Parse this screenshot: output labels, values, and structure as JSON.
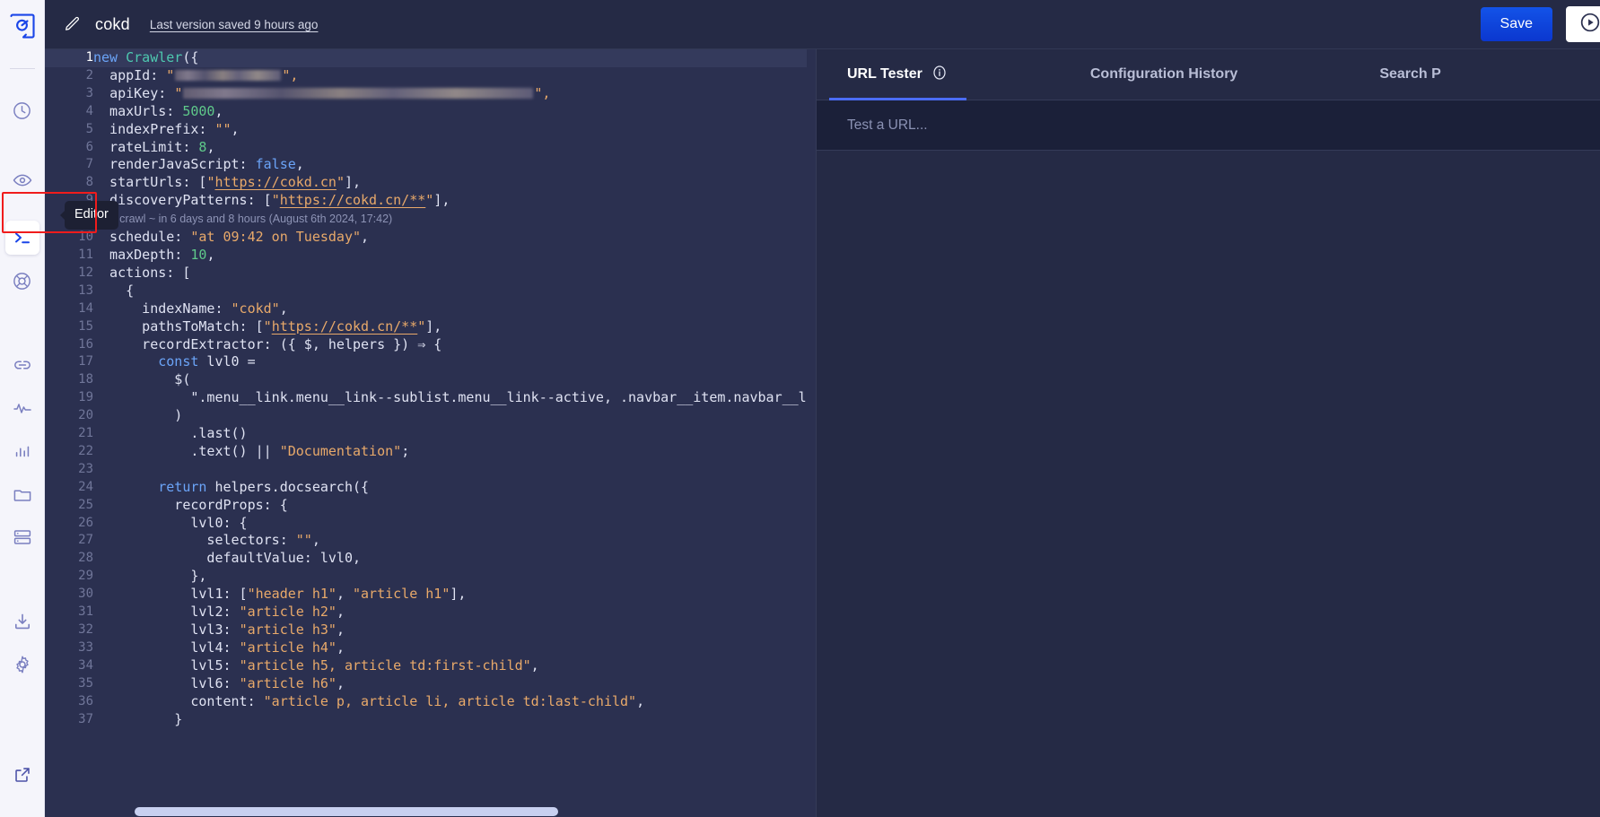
{
  "app": {
    "logo_icon": "algolia-logo-icon",
    "background": "#272c46"
  },
  "sidebar": {
    "items": [
      {
        "id": "history",
        "icon": "clock-icon",
        "selected": false
      },
      {
        "id": "monitoring",
        "icon": "eye-icon",
        "selected": false
      },
      {
        "id": "editor",
        "icon": "terminal-icon",
        "selected": true
      },
      {
        "id": "support",
        "icon": "lifebuoy-icon",
        "selected": false
      },
      {
        "id": "urls",
        "icon": "link-icon",
        "selected": false
      },
      {
        "id": "activity",
        "icon": "pulse-icon",
        "selected": false
      },
      {
        "id": "analytics",
        "icon": "bar-chart-icon",
        "selected": false
      },
      {
        "id": "files",
        "icon": "folder-icon",
        "selected": false
      },
      {
        "id": "indices",
        "icon": "database-icon",
        "selected": false
      },
      {
        "id": "download",
        "icon": "download-icon",
        "selected": false
      },
      {
        "id": "settings",
        "icon": "gear-icon",
        "selected": false
      },
      {
        "id": "external",
        "icon": "external-link-icon",
        "selected": false
      }
    ],
    "tooltip": "Editor",
    "highlight_color": "#f01c1c"
  },
  "header": {
    "edit_icon": "pencil-icon",
    "title": "cokd",
    "saved_status": "Last version saved 9 hours ago",
    "save_label": "Save",
    "run_icon": "play-circle-icon",
    "accent_color": "#0b37cf"
  },
  "editor": {
    "active_line": 1,
    "inline_annotation": {
      "after_line": 9,
      "text": "Next crawl ~ in 6 days and 8 hours (August 6th 2024, 17:42)"
    },
    "lines": [
      {
        "n": 1,
        "text": "new Crawler({"
      },
      {
        "n": 2,
        "text": "  appId: \"██████████\",",
        "redacted": "short"
      },
      {
        "n": 3,
        "text": "  apiKey: \"████████████████████████████████\",",
        "redacted": "long"
      },
      {
        "n": 4,
        "text": "  maxUrls: 5000,"
      },
      {
        "n": 5,
        "text": "  indexPrefix: \"\","
      },
      {
        "n": 6,
        "text": "  rateLimit: 8,"
      },
      {
        "n": 7,
        "text": "  renderJavaScript: false,"
      },
      {
        "n": 8,
        "text": "  startUrls: [\"https://cokd.cn\"],"
      },
      {
        "n": 9,
        "text": "  discoveryPatterns: [\"https://cokd.cn/**\"],"
      },
      {
        "n": 10,
        "text": "  schedule: \"at 09:42 on Tuesday\","
      },
      {
        "n": 11,
        "text": "  maxDepth: 10,"
      },
      {
        "n": 12,
        "text": "  actions: ["
      },
      {
        "n": 13,
        "text": "    {"
      },
      {
        "n": 14,
        "text": "      indexName: \"cokd\","
      },
      {
        "n": 15,
        "text": "      pathsToMatch: [\"https://cokd.cn/**\"],"
      },
      {
        "n": 16,
        "text": "      recordExtractor: ({ $, helpers }) ⇒ {"
      },
      {
        "n": 17,
        "text": "        const lvl0 ="
      },
      {
        "n": 18,
        "text": "          $("
      },
      {
        "n": 19,
        "text": "            \".menu__link.menu__link--sublist.menu__link--active, .navbar__item.navbar__li"
      },
      {
        "n": 20,
        "text": "          )"
      },
      {
        "n": 21,
        "text": "            .last()"
      },
      {
        "n": 22,
        "text": "            .text() || \"Documentation\";"
      },
      {
        "n": 23,
        "text": ""
      },
      {
        "n": 24,
        "text": "        return helpers.docsearch({"
      },
      {
        "n": 25,
        "text": "          recordProps: {"
      },
      {
        "n": 26,
        "text": "            lvl0: {"
      },
      {
        "n": 27,
        "text": "              selectors: \"\","
      },
      {
        "n": 28,
        "text": "              defaultValue: lvl0,"
      },
      {
        "n": 29,
        "text": "            },"
      },
      {
        "n": 30,
        "text": "            lvl1: [\"header h1\", \"article h1\"],"
      },
      {
        "n": 31,
        "text": "            lvl2: \"article h2\","
      },
      {
        "n": 32,
        "text": "            lvl3: \"article h3\","
      },
      {
        "n": 33,
        "text": "            lvl4: \"article h4\","
      },
      {
        "n": 34,
        "text": "            lvl5: \"article h5, article td:first-child\","
      },
      {
        "n": 35,
        "text": "            lvl6: \"article h6\","
      },
      {
        "n": 36,
        "text": "            content: \"article p, article li, article td:last-child\","
      },
      {
        "n": 37,
        "text": "          }"
      }
    ],
    "colors": {
      "background": "#2b3050",
      "active_line": "#343a5c",
      "keyword": "#6ba4f8",
      "class": "#4ec9b0",
      "string": "#e8a96a",
      "number": "#5fc98a",
      "text": "#dfe2f2",
      "line_number": "#707699"
    }
  },
  "panel": {
    "tabs": [
      {
        "id": "url-tester",
        "label": "URL Tester",
        "active": true,
        "info_icon": "info-icon"
      },
      {
        "id": "configuration-history",
        "label": "Configuration History",
        "active": false
      },
      {
        "id": "search-preview",
        "label": "Search P",
        "active": false
      }
    ],
    "url_input": {
      "value": "",
      "placeholder": "Test a URL..."
    },
    "accent_color": "#4b6cf5"
  }
}
